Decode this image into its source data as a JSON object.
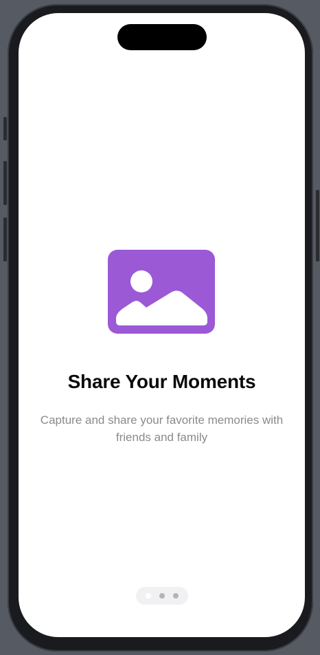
{
  "onboarding": {
    "title": "Share Your Moments",
    "subtitle": "Capture and share your favorite memories with friends and family",
    "hero_icon": "photo-icon",
    "accent_color": "#9b59d6"
  },
  "pager": {
    "page_count": 3,
    "current_page": 1
  }
}
